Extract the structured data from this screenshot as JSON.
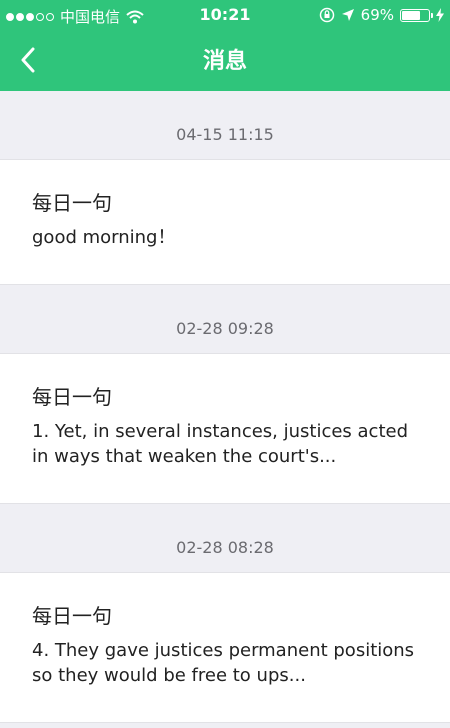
{
  "status_bar": {
    "carrier": "中国电信",
    "time": "10:21",
    "battery_percent": "69%",
    "battery_level": 0.69
  },
  "nav": {
    "title": "消息"
  },
  "messages": [
    {
      "time": "04-15 11:15",
      "title": "每日一句",
      "body": "good morning！"
    },
    {
      "time": "02-28 09:28",
      "title": "每日一句",
      "body": "1. Yet, in several instances, justices acted in ways that weaken the court's..."
    },
    {
      "time": "02-28 08:28",
      "title": "每日一句",
      "body": "4. They gave justices permanent positions so they would be free to ups..."
    }
  ],
  "colors": {
    "accent": "#2fc57b",
    "background": "#efeff4"
  }
}
